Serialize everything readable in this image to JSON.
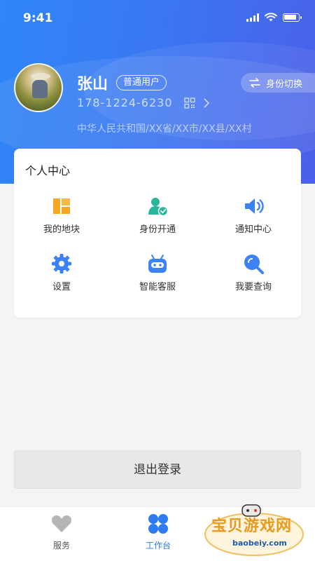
{
  "status_bar": {
    "time": "9:41"
  },
  "profile": {
    "name": "张山",
    "badge": "普通用户",
    "phone": "178-1224-6230",
    "address": "中华人民共和国/XX省/XX市/XX县/XX村"
  },
  "switch_identity": {
    "label": "身份切换"
  },
  "personal_center": {
    "title": "个人中心",
    "items": [
      {
        "label": "我的地块",
        "icon": "map-plot-icon",
        "color": "#f5a623"
      },
      {
        "label": "身份开通",
        "icon": "user-verified-icon",
        "color": "#2bb59a"
      },
      {
        "label": "通知中心",
        "icon": "speaker-icon",
        "color": "#3b82f6"
      },
      {
        "label": "设置",
        "icon": "gear-icon",
        "color": "#3b82f6"
      },
      {
        "label": "智能客服",
        "icon": "robot-icon",
        "color": "#3b82f6"
      },
      {
        "label": "我要查询",
        "icon": "search-icon",
        "color": "#3b82f6"
      }
    ]
  },
  "logout": {
    "label": "退出登录"
  },
  "tabbar": {
    "tabs": [
      {
        "label": "服务",
        "icon": "heart-icon",
        "active": false
      },
      {
        "label": "工作台",
        "icon": "workbench-icon",
        "active": true
      }
    ]
  },
  "watermark": {
    "text": "宝贝游戏网",
    "url": "baobeiy.com"
  },
  "colors": {
    "primary": "#3a78f2",
    "accent_orange": "#f5a623",
    "accent_green": "#2bb59a",
    "inactive": "#b5b5b5"
  }
}
